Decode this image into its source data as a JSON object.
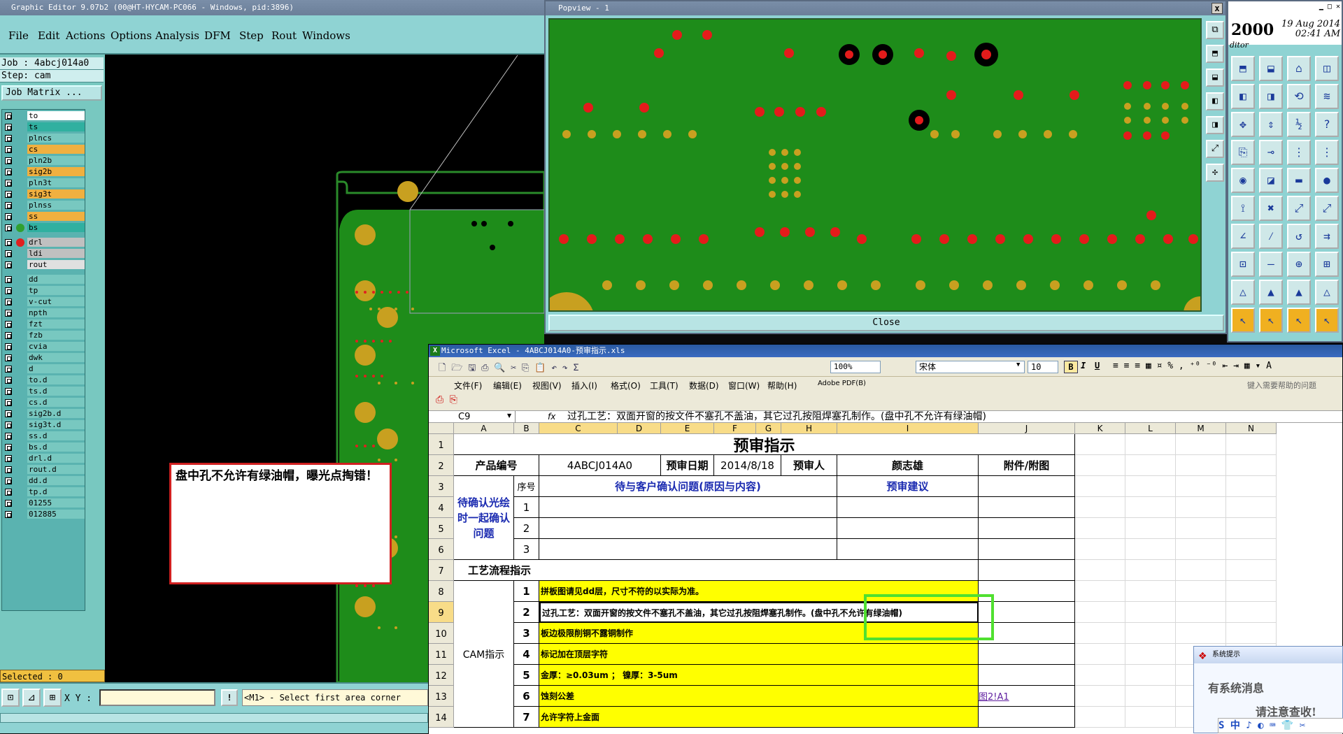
{
  "graphic_editor": {
    "title": "Graphic Editor 9.07b2 (00@HT-HYCAM-PC066 - Windows, pid:3896)",
    "menu": [
      "File",
      "Edit",
      "Actions",
      "Options",
      "Analysis",
      "DFM",
      "Step",
      "Rout",
      "Windows"
    ],
    "job": "Job : 4abcj014a0",
    "step": "Step: cam",
    "job_matrix": "Job Matrix ...",
    "layers": [
      {
        "name": "to",
        "color": "#ffffff"
      },
      {
        "name": "ts",
        "color": "#30b0a0"
      },
      {
        "name": "plncs",
        "color": "#78c8c0"
      },
      {
        "name": "cs",
        "color": "#f0b040"
      },
      {
        "name": "pln2b",
        "color": "#78c8c0"
      },
      {
        "name": "sig2b",
        "color": "#f0b040"
      },
      {
        "name": "pln3t",
        "color": "#78c8c0"
      },
      {
        "name": "sig3t",
        "color": "#f0b040"
      },
      {
        "name": "plnss",
        "color": "#78c8c0"
      },
      {
        "name": "ss",
        "color": "#f0b040"
      },
      {
        "name": "bs",
        "color": "#30b0a0"
      },
      {
        "name": "drl",
        "color": "#c0c0c0"
      },
      {
        "name": "ldi",
        "color": "#c0c0c0"
      },
      {
        "name": "rout",
        "color": "#e0e0e0"
      },
      {
        "name": "dd",
        "color": "#78c8c0"
      },
      {
        "name": "tp",
        "color": "#78c8c0"
      },
      {
        "name": "v-cut",
        "color": "#78c8c0"
      },
      {
        "name": "npth",
        "color": "#78c8c0"
      },
      {
        "name": "fzt",
        "color": "#78c8c0"
      },
      {
        "name": "fzb",
        "color": "#78c8c0"
      },
      {
        "name": "cvia",
        "color": "#78c8c0"
      },
      {
        "name": "dwk",
        "color": "#78c8c0"
      },
      {
        "name": "d",
        "color": "#78c8c0"
      },
      {
        "name": "to.d",
        "color": "#78c8c0"
      },
      {
        "name": "ts.d",
        "color": "#78c8c0"
      },
      {
        "name": "cs.d",
        "color": "#78c8c0"
      },
      {
        "name": "sig2b.d",
        "color": "#78c8c0"
      },
      {
        "name": "sig3t.d",
        "color": "#78c8c0"
      },
      {
        "name": "ss.d",
        "color": "#78c8c0"
      },
      {
        "name": "bs.d",
        "color": "#78c8c0"
      },
      {
        "name": "drl.d",
        "color": "#78c8c0"
      },
      {
        "name": "rout.d",
        "color": "#78c8c0"
      },
      {
        "name": "dd.d",
        "color": "#78c8c0"
      },
      {
        "name": "tp.d",
        "color": "#78c8c0"
      },
      {
        "name": "01255",
        "color": "#78c8c0"
      },
      {
        "name": "012885",
        "color": "#78c8c0"
      }
    ],
    "selected": "Selected : 0",
    "xy_label": "X Y :",
    "xy_value": "",
    "prompt": "<M1> - Select first area corner",
    "note": "盘中孔不允许有绿油帽，曝光点掏错！"
  },
  "popview": {
    "title": "Popview - 1",
    "close_label": "Close",
    "close_x": "x"
  },
  "toolbox": {
    "year": "2000",
    "date": "19 Aug 2014",
    "time": "02:41 AM",
    "sub": "ditor"
  },
  "excel": {
    "title": "Microsoft Excel - 4ABCJ014A0-预审指示.xls",
    "menu": [
      "文件(F)",
      "编辑(E)",
      "视图(V)",
      "插入(I)",
      "格式(O)",
      "工具(T)",
      "数据(D)",
      "窗口(W)",
      "帮助(H)",
      "Adobe PDF(B)"
    ],
    "help_placeholder": "键入需要帮助的问题",
    "zoom": "100%",
    "font": "宋体",
    "font_size": "10",
    "name_box": "C9",
    "fx": "fx",
    "formula": "过孔工艺：双面开窗的按文件不塞孔不盖油，其它过孔按阻焊塞孔制作。(盘中孔不允许有绿油帽)",
    "columns": [
      "A",
      "B",
      "C",
      "D",
      "E",
      "F",
      "G",
      "H",
      "I",
      "J",
      "K",
      "L",
      "M",
      "N"
    ],
    "rows": [
      "1",
      "2",
      "3",
      "4",
      "5",
      "6",
      "7",
      "8",
      "9",
      "10",
      "11",
      "12",
      "13",
      "14"
    ],
    "sheet": {
      "title": "预审指示",
      "product_no_label": "产品编号",
      "product_no": "4ABCJ014A0",
      "date_label": "预审日期",
      "date": "2014/8/18",
      "reviewer_label": "预审人",
      "reviewer": "颜志雄",
      "attach_label": "附件/附图",
      "confirm_label": "待确认光绘时一起确认问题",
      "seq_label": "序号",
      "question_label": "待与客户确认问题(原因与内容)",
      "suggest_label": "预审建议",
      "q_nums": [
        "1",
        "2",
        "3"
      ],
      "process_label": "工艺流程指示",
      "cam_label": "CAM指示",
      "instructions": [
        {
          "n": "1",
          "text": "拼板图请见dd层，尺寸不符的以实际为准。"
        },
        {
          "n": "2",
          "text": "过孔工艺：双面开窗的按文件不塞孔不盖油，其它过孔按阻焊塞孔制作。(盘中孔不允许有绿油帽)"
        },
        {
          "n": "3",
          "text": "板边极限削铜不露铜制作"
        },
        {
          "n": "4",
          "text": "标记加在顶层字符"
        },
        {
          "n": "5",
          "text": "金厚：≥0.03um  ；  镍厚：3-5um"
        },
        {
          "n": "6",
          "text": "蚀刻公差"
        },
        {
          "n": "7",
          "text": "允许字符上金面"
        }
      ],
      "link": "图2!A1"
    }
  },
  "notification": {
    "title": "系统提示",
    "line1": "有系统消息",
    "line2": "请注意查收!",
    "ime": "S 中 ♪ ◐ ⌨ 👕 ✂"
  }
}
